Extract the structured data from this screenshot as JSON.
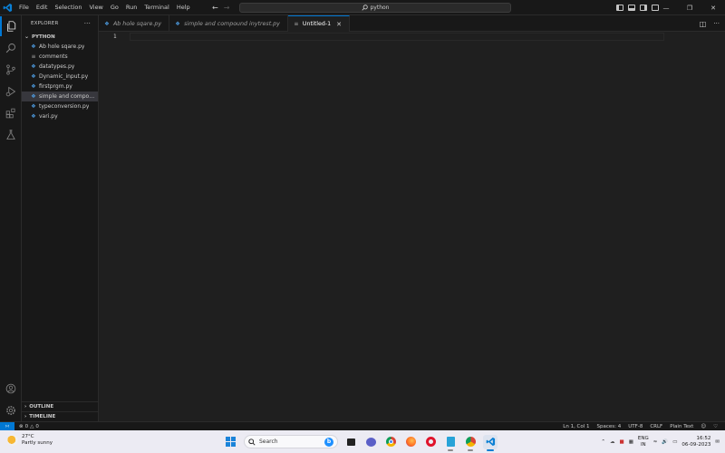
{
  "titlebar": {
    "menu": [
      "File",
      "Edit",
      "Selection",
      "View",
      "Go",
      "Run",
      "Terminal",
      "Help"
    ],
    "search_text": "python"
  },
  "sidebar": {
    "title": "EXPLORER",
    "folder": "PYTHON",
    "files": [
      {
        "name": "Ab hole sqare.py",
        "icon": "python-file-icon"
      },
      {
        "name": "comments",
        "icon": "text-file-icon"
      },
      {
        "name": "datatypes.py",
        "icon": "python-file-icon"
      },
      {
        "name": "Dynamic_input.py",
        "icon": "python-file-icon"
      },
      {
        "name": "firstprgm.py",
        "icon": "python-file-icon"
      },
      {
        "name": "simple and compound inytrest.py",
        "icon": "python-file-icon",
        "selected": true
      },
      {
        "name": "typeconversion.py",
        "icon": "python-file-icon"
      },
      {
        "name": "vari.py",
        "icon": "python-file-icon"
      }
    ],
    "outline": "OUTLINE",
    "timeline": "TIMELINE"
  },
  "tabs": [
    {
      "label": "Ab hole sqare.py",
      "icon": "python-file-icon",
      "active": false
    },
    {
      "label": "simple and compound inytrest.py",
      "icon": "python-file-icon",
      "active": false
    },
    {
      "label": "Untitled-1",
      "icon": "text-file-icon",
      "active": true
    }
  ],
  "editor": {
    "line_number": "1"
  },
  "statusbar": {
    "errors": "0",
    "warnings": "0",
    "position": "Ln 1, Col 1",
    "spaces": "Spaces: 4",
    "encoding": "UTF-8",
    "eol": "CRLF",
    "language": "Plain Text"
  },
  "taskbar": {
    "weather_temp": "27°C",
    "weather_desc": "Partly sunny",
    "search_label": "Search",
    "lang_top": "ENG",
    "lang_bottom": "IN",
    "time": "16:52",
    "date": "06-09-2023"
  },
  "colors": {
    "accent": "#0078d4",
    "python_icon": "#4fa0e8"
  }
}
